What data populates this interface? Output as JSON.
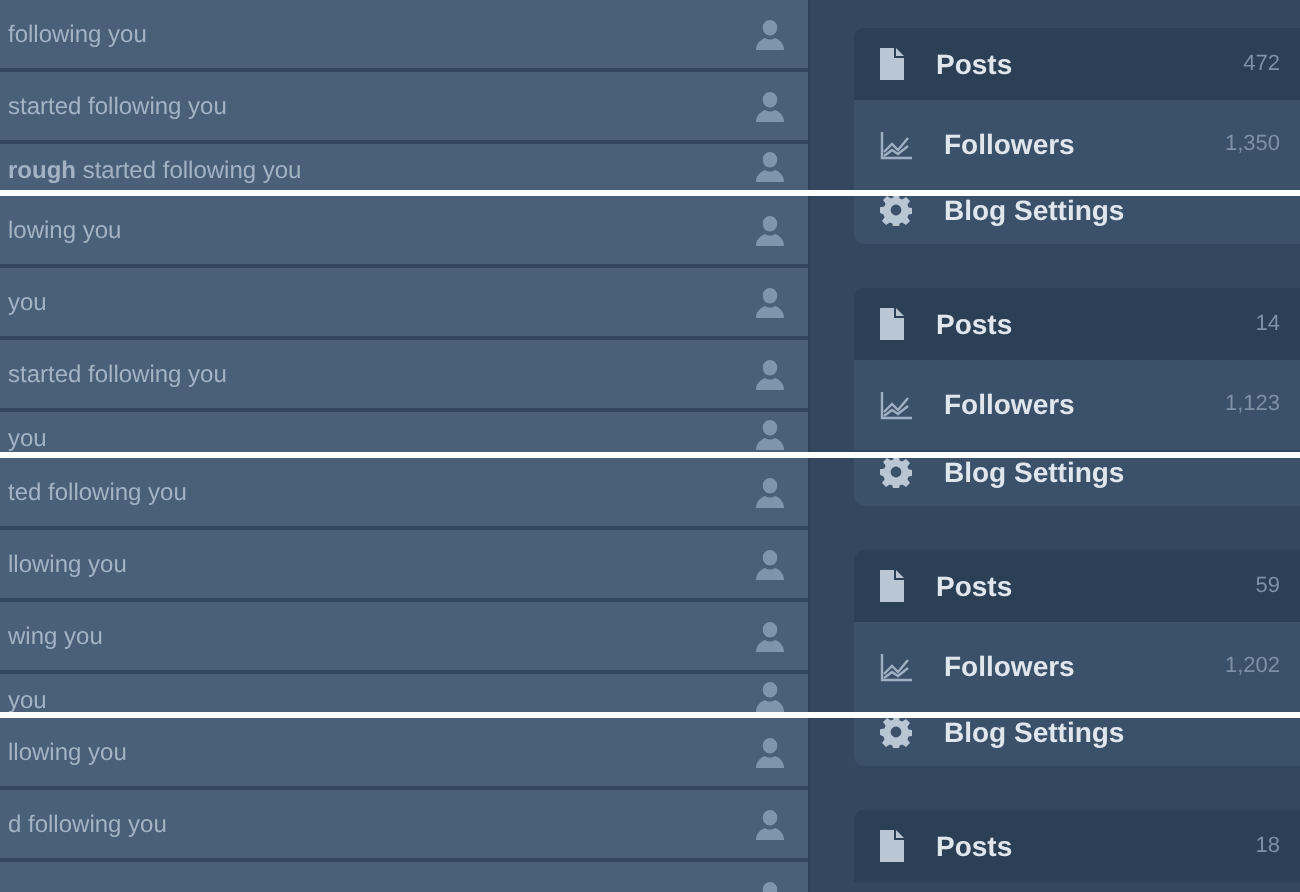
{
  "strips": [
    {
      "notifications": [
        {
          "text": "following you"
        },
        {
          "text": "started following you"
        },
        {
          "text": "**rough** started following you"
        }
      ],
      "blog_menu": [
        {
          "kind": "posts",
          "label": "Posts",
          "count": "472"
        },
        {
          "kind": "followers",
          "label": "Followers",
          "count": "1,350"
        }
      ]
    },
    {
      "notifications": [
        {
          "text": "lowing you"
        },
        {
          "text": "you"
        },
        {
          "text": "started following you"
        },
        {
          "text": "you"
        }
      ],
      "blog_menu": [
        {
          "kind": "settings",
          "label": "Blog Settings"
        },
        {
          "kind": "posts",
          "label": "Posts",
          "count": "14"
        },
        {
          "kind": "followers",
          "label": "Followers",
          "count": "1,123"
        }
      ]
    },
    {
      "notifications": [
        {
          "text": "ted following you"
        },
        {
          "text": "llowing you"
        },
        {
          "text": "wing you"
        },
        {
          "text": "you"
        }
      ],
      "blog_menu": [
        {
          "kind": "settings",
          "label": "Blog Settings"
        },
        {
          "kind": "posts",
          "label": "Posts",
          "count": "59"
        },
        {
          "kind": "followers",
          "label": "Followers",
          "count": "1,202"
        }
      ]
    },
    {
      "notifications": [
        {
          "text": "llowing you"
        },
        {
          "text": "d following you"
        }
      ],
      "blog_menu": [
        {
          "kind": "settings",
          "label": "Blog Settings"
        },
        {
          "kind": "posts",
          "label": "Posts",
          "count": "18"
        }
      ]
    }
  ]
}
